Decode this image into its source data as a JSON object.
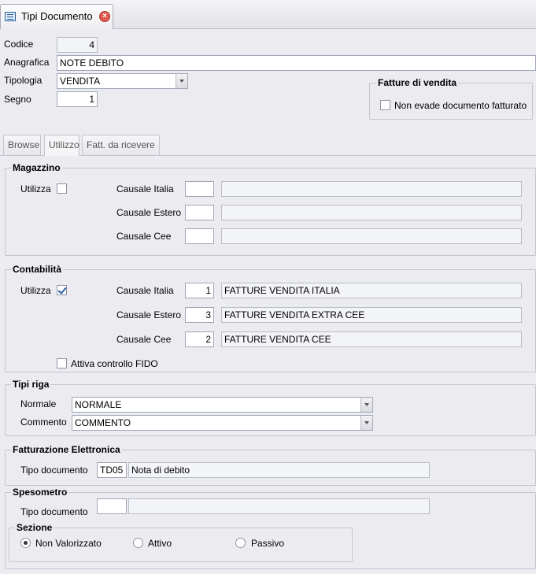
{
  "window": {
    "tab_title": "Tipi Documento",
    "close_glyph": "×",
    "icon": "document-list-icon"
  },
  "header": {
    "codice_label": "Codice",
    "codice_value": "4",
    "anagrafica_label": "Anagrafica",
    "anagrafica_value": "NOTE DEBITO",
    "tipologia_label": "Tipologia",
    "tipologia_value": "VENDITA",
    "segno_label": "Segno",
    "segno_value": "1"
  },
  "fatture_vendita": {
    "title": "Fatture di vendita",
    "non_evade_label": "Non evade documento fatturato",
    "non_evade_checked": false
  },
  "tabs": [
    {
      "label": "Browse",
      "active": false
    },
    {
      "label": "Utilizzo",
      "active": true
    },
    {
      "label": "Fatt. da ricevere",
      "active": false
    }
  ],
  "magazzino": {
    "title": "Magazzino",
    "utilizza_label": "Utilizza",
    "utilizza_checked": false,
    "causale_italia_label": "Causale Italia",
    "causale_italia_code": "",
    "causale_italia_desc": "",
    "causale_estero_label": "Causale Estero",
    "causale_estero_code": "",
    "causale_estero_desc": "",
    "causale_cee_label": "Causale Cee",
    "causale_cee_code": "",
    "causale_cee_desc": ""
  },
  "contabilita": {
    "title": "Contabilità",
    "utilizza_label": "Utilizza",
    "utilizza_checked": true,
    "causale_italia_label": "Causale Italia",
    "causale_italia_code": "1",
    "causale_italia_desc": "FATTURE VENDITA ITALIA",
    "causale_estero_label": "Causale Estero",
    "causale_estero_code": "3",
    "causale_estero_desc": "FATTURE VENDITA EXTRA CEE",
    "causale_cee_label": "Causale Cee",
    "causale_cee_code": "2",
    "causale_cee_desc": "FATTURE VENDITA CEE",
    "fido_label": "Attiva controllo FIDO",
    "fido_checked": false
  },
  "tipi_riga": {
    "title": "Tipi riga",
    "normale_label": "Normale",
    "normale_value": "NORMALE",
    "commento_label": "Commento",
    "commento_value": "COMMENTO"
  },
  "fatturazione": {
    "title": "Fatturazione Elettronica",
    "tipo_label": "Tipo documento",
    "tipo_code": "TD05",
    "tipo_desc": "Nota di debito"
  },
  "spesometro": {
    "title": "Spesometro",
    "tipo_label": "Tipo documento",
    "tipo_code": "",
    "tipo_desc": "",
    "sezione_title": "Sezione",
    "options": [
      {
        "label": "Non Valorizzato",
        "selected": true
      },
      {
        "label": "Attivo",
        "selected": false
      },
      {
        "label": "Passivo",
        "selected": false
      }
    ]
  }
}
